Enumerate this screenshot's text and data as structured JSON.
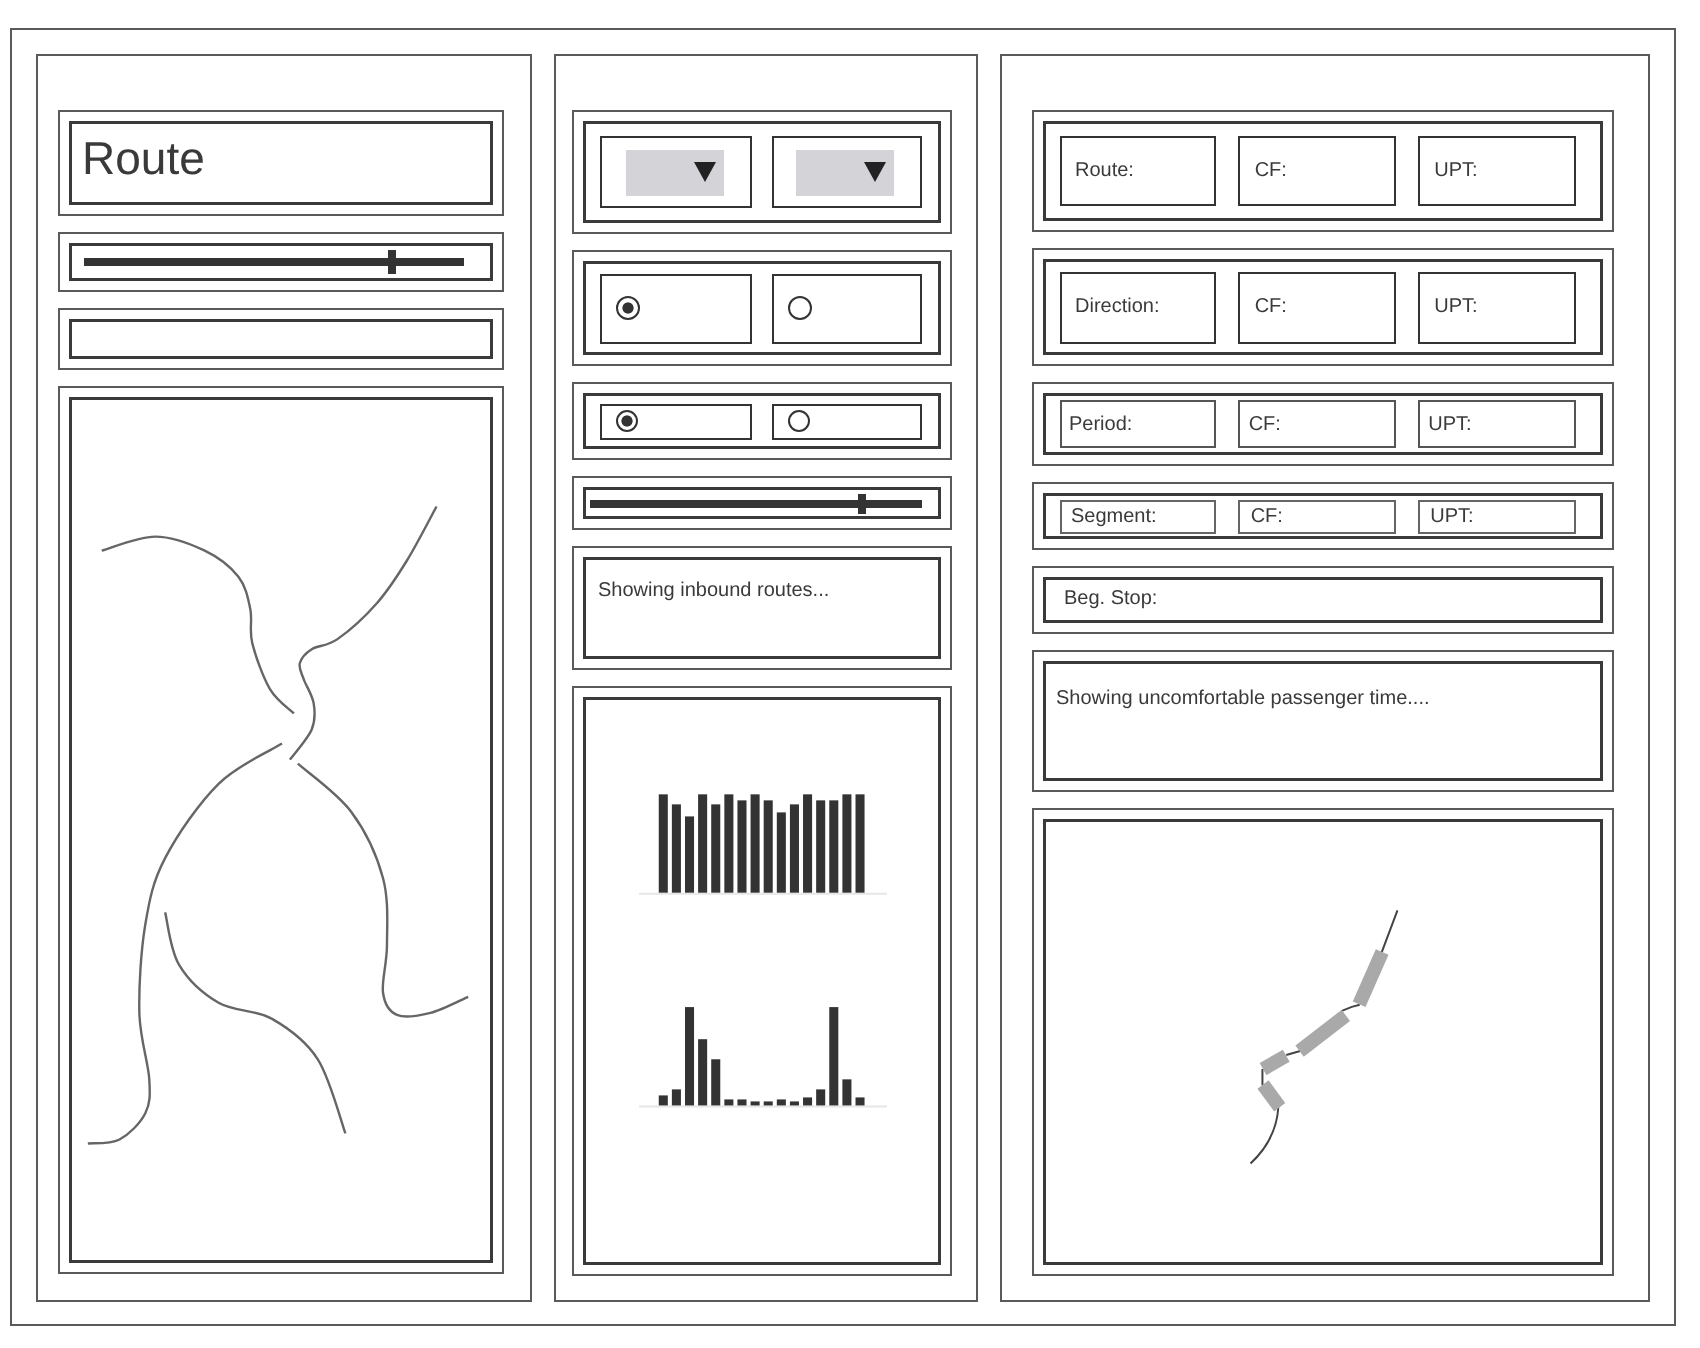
{
  "left_panel": {
    "title": "Route",
    "slider": {
      "level": 0.81
    }
  },
  "middle_panel": {
    "radio_groups": [
      {
        "options": [
          {
            "selected": true
          },
          {
            "selected": false
          }
        ]
      },
      {
        "options": [
          {
            "selected": true
          },
          {
            "selected": false
          }
        ]
      }
    ],
    "slider": {
      "level": 0.82
    },
    "status_text": "Showing inbound routes..."
  },
  "right_panel": {
    "stat_rows": [
      {
        "fields": [
          "Route:",
          "CF:",
          "UPT:"
        ]
      },
      {
        "fields": [
          "Direction:",
          "CF:",
          "UPT:"
        ]
      },
      {
        "fields": [
          "Period:",
          "CF:",
          "UPT:"
        ]
      },
      {
        "fields": [
          "Segment:",
          "CF:",
          "UPT:"
        ]
      }
    ],
    "beg_stop": "Beg. Stop:",
    "status_text": "Showing uncomfortable passenger time...."
  }
}
